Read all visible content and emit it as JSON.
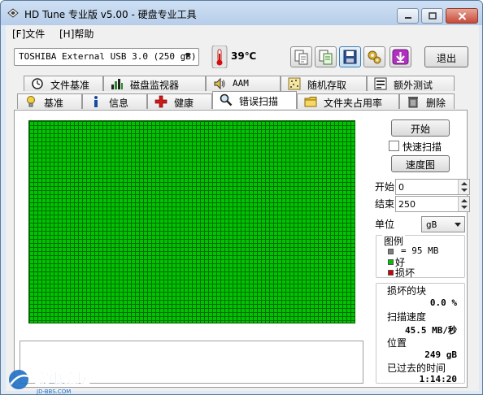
{
  "window": {
    "title": "HD Tune 专业版 v5.00 - 硬盘专业工具"
  },
  "menu": [
    {
      "label": "[F]文件"
    },
    {
      "label": "[H]帮助"
    }
  ],
  "toolbar": {
    "drive": "TOSHIBA External USB 3.0 (250 gB)",
    "temperature": "39℃",
    "exit_label": "退出",
    "buttons": [
      "copy-icon",
      "copy-info-icon",
      "save-icon",
      "options-icon",
      "download-icon"
    ]
  },
  "tabs_top": [
    {
      "label": "文件基准",
      "icon": "file-benchmark-icon"
    },
    {
      "label": "磁盘监视器",
      "icon": "disk-monitor-icon"
    },
    {
      "label": "AAM",
      "icon": "speaker-icon"
    },
    {
      "label": "随机存取",
      "icon": "random-access-icon"
    },
    {
      "label": "额外测试",
      "icon": "extra-tests-icon"
    }
  ],
  "tabs_bottom": [
    {
      "label": "基准",
      "icon": "benchmark-icon"
    },
    {
      "label": "信息",
      "icon": "info-icon"
    },
    {
      "label": "健康",
      "icon": "health-icon"
    },
    {
      "label": "错误扫描",
      "icon": "error-scan-icon",
      "active": true
    },
    {
      "label": "文件夹占用率",
      "icon": "folder-usage-icon"
    },
    {
      "label": "删除",
      "icon": "erase-icon"
    }
  ],
  "scan": {
    "start_button": "开始",
    "quick_scan_label": "快速扫描",
    "quick_scan_checked": false,
    "speed_map_button": "速度图",
    "start_label": "开始",
    "start_value": "0",
    "end_label": "结束",
    "end_value": "250",
    "unit_label": "单位",
    "unit_value": "gB",
    "block_status": "all-good"
  },
  "legend": {
    "title": "图例",
    "block_size": "= 95 MB",
    "good": "好",
    "damaged": "损坏",
    "colors": {
      "block": "#808080",
      "good": "#00c400",
      "damaged": "#d00000"
    }
  },
  "stats": {
    "damaged_blocks_label": "损坏的块",
    "damaged_blocks_value": "0.0 %",
    "scan_speed_label": "扫描速度",
    "scan_speed_value": "45.5 MB/秒",
    "position_label": "位置",
    "position_value": "249 gB",
    "elapsed_label": "已过去的时间",
    "elapsed_value": "1:14:20"
  },
  "watermark": {
    "text": "家电论坛",
    "subtext": "JD-BBS.COM"
  }
}
